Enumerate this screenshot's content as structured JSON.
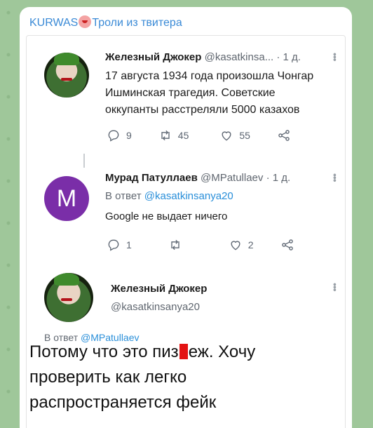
{
  "channel": {
    "title_prefix": "KURWAS",
    "title_suffix": "Троли из твитера"
  },
  "tweet1": {
    "name": "Железный Джокер",
    "handle": "@kasatkinsa...",
    "time": "· 1 д.",
    "text_l1": "17 августа  1934 года произошла Чонгар",
    "text_l2": "Ишминская трагедия.  Советские",
    "text_l3": "оккупанты  расстреляли 5000 казахов",
    "replies": "9",
    "retweets": "45",
    "likes": "55"
  },
  "tweet2": {
    "name": "Мурад Патуллаев",
    "handle": "@MPatullaev",
    "time": "· 1 д.",
    "avatar_letter": "M",
    "reply_prefix": "В ответ",
    "reply_mention": "@kasatkinsanya20",
    "text": "Google не выдает ничего",
    "replies": "1",
    "likes": "2"
  },
  "tweet3": {
    "name": "Железный Джокер",
    "handle": "@kasatkinsanya20",
    "reply_prefix": "В ответ",
    "reply_mention": "@MPatullaev",
    "text_l1_a": "Потому  что это пиз",
    "text_l1_b": "еж. Хочу",
    "text_l2": "проверить как легко",
    "text_l3": "распространяется  фейк"
  }
}
